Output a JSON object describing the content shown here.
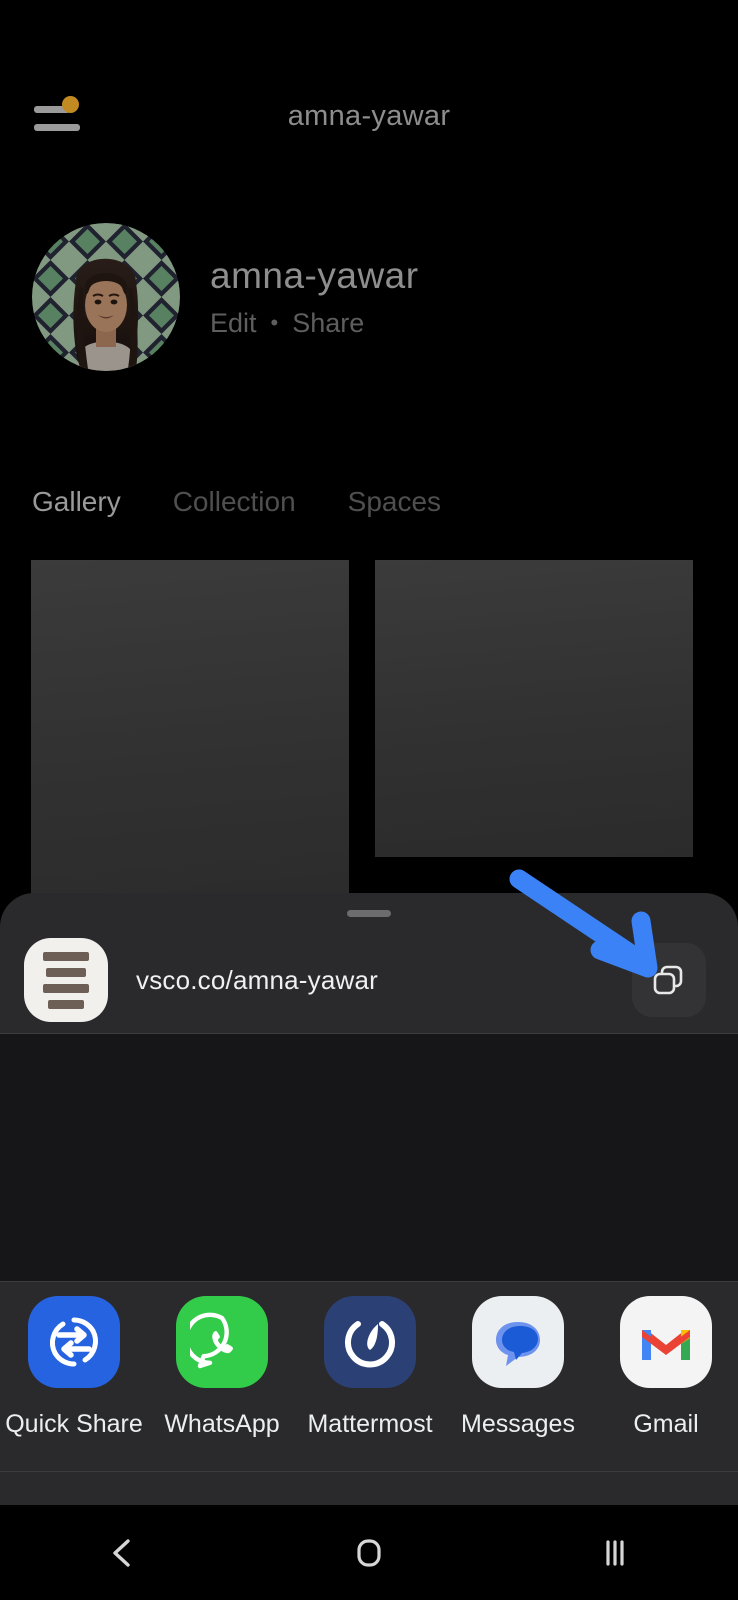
{
  "app": {
    "name": "VSCO",
    "topbar": {
      "title": "amna-yawar",
      "menu_icon": "hamburger-menu-icon",
      "notification_dot_color": "#c28b21"
    },
    "profile": {
      "avatar_alt": "amna-yawar profile photo",
      "name": "amna-yawar",
      "edit_label": "Edit",
      "separator": "•",
      "share_label": "Share"
    },
    "tabs": [
      {
        "label": "Gallery",
        "active": true
      },
      {
        "label": "Collection",
        "active": false
      },
      {
        "label": "Spaces",
        "active": false
      }
    ],
    "gallery": {
      "items": [
        {
          "alt": "gallery-thumbnail-1"
        },
        {
          "alt": "gallery-thumbnail-2"
        }
      ]
    }
  },
  "share_sheet": {
    "drag_handle": "drag-handle",
    "link": {
      "preview_icon": "link-preview-icon",
      "url": "vsco.co/amna-yawar",
      "copy_icon": "copy-icon",
      "copy_label": "Copy link"
    },
    "apps": [
      {
        "label": "Quick Share",
        "icon": "quick-share-icon",
        "color": "#2663e0"
      },
      {
        "label": "WhatsApp",
        "icon": "whatsapp-icon",
        "color": "#33cc4a"
      },
      {
        "label": "Mattermost",
        "icon": "mattermost-icon",
        "color": "#2b4075"
      },
      {
        "label": "Messages",
        "icon": "messages-icon",
        "color": "#eceff1"
      },
      {
        "label": "Gmail",
        "icon": "gmail-icon",
        "color": "#ffffff"
      }
    ]
  },
  "annotation": {
    "type": "arrow",
    "color": "#3b82f6",
    "points_to": "copy-icon"
  },
  "navbar": {
    "buttons": [
      {
        "label": "Back",
        "icon": "back-chevron-icon"
      },
      {
        "label": "Home",
        "icon": "home-square-icon"
      },
      {
        "label": "Recents",
        "icon": "recents-lines-icon"
      }
    ]
  },
  "colors": {
    "background": "#000000",
    "sheet_background": "#2a2a2c",
    "accent_blue": "#3b82f6",
    "text_primary": "#eceff1",
    "text_muted": "#8d8d8d"
  }
}
